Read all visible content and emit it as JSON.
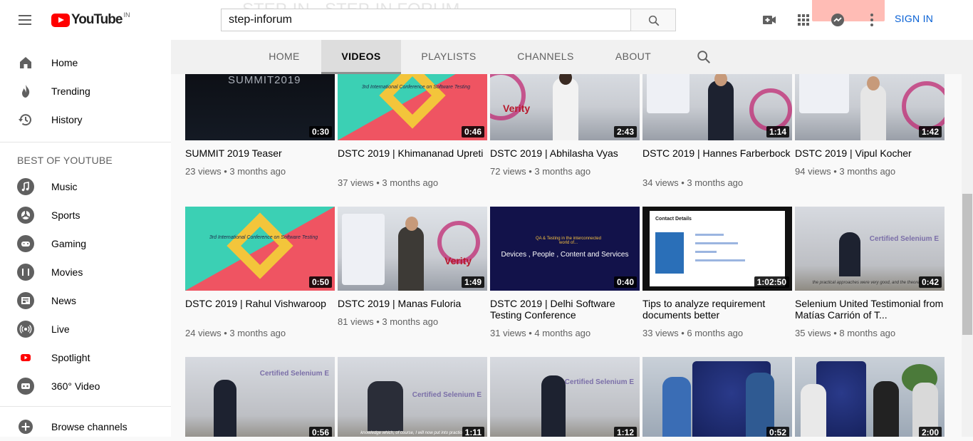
{
  "masthead": {
    "logo_text": "YouTube",
    "country_code": "IN",
    "search_value": "step-inforum",
    "sign_in_label": "SIGN IN",
    "icons": [
      "create-video-icon",
      "apps-grid-icon",
      "messages-icon",
      "more-vert-icon"
    ]
  },
  "sidebar": {
    "primary": [
      {
        "label": "Home",
        "icon": "home-icon"
      },
      {
        "label": "Trending",
        "icon": "trending-flame-icon"
      },
      {
        "label": "History",
        "icon": "history-icon"
      }
    ],
    "section_title": "BEST OF YOUTUBE",
    "best_of": [
      {
        "label": "Music",
        "icon": "music-icon"
      },
      {
        "label": "Sports",
        "icon": "sports-icon"
      },
      {
        "label": "Gaming",
        "icon": "gaming-icon"
      },
      {
        "label": "Movies",
        "icon": "movies-icon"
      },
      {
        "label": "News",
        "icon": "news-icon"
      },
      {
        "label": "Live",
        "icon": "live-icon"
      },
      {
        "label": "Spotlight",
        "icon": "spotlight-icon"
      },
      {
        "label": "360° Video",
        "icon": "vr-360-icon"
      }
    ],
    "browse_channels": "Browse channels"
  },
  "tabs": [
    {
      "label": "HOME"
    },
    {
      "label": "VIDEOS",
      "active": true
    },
    {
      "label": "PLAYLISTS"
    },
    {
      "label": "CHANNELS"
    },
    {
      "label": "ABOUT"
    }
  ],
  "videos": [
    {
      "title": "SUMMIT 2019 Teaser",
      "views": "23 views",
      "age": "3 months ago",
      "duration": "0:30"
    },
    {
      "title": "DSTC 2019 | Khimananad Upreti",
      "views": "37 views",
      "age": "3 months ago",
      "duration": "0:46"
    },
    {
      "title": "DSTC 2019 | Abhilasha Vyas",
      "views": "72 views",
      "age": "3 months ago",
      "duration": "2:43"
    },
    {
      "title": "DSTC 2019 | Hannes Farberbock",
      "views": "34 views",
      "age": "3 months ago",
      "duration": "1:14"
    },
    {
      "title": "DSTC 2019 | Vipul Kocher",
      "views": "94 views",
      "age": "3 months ago",
      "duration": "1:42"
    },
    {
      "title": "DSTC 2019 | Rahul Vishwaroop",
      "views": "24 views",
      "age": "3 months ago",
      "duration": "0:50"
    },
    {
      "title": "DSTC 2019 | Manas Fuloria",
      "views": "81 views",
      "age": "3 months ago",
      "duration": "1:49"
    },
    {
      "title": "DSTC 2019 | Delhi Software Testing Conference",
      "views": "31 views",
      "age": "4 months ago",
      "duration": "0:40"
    },
    {
      "title": "Tips to analyze requirement documents better",
      "views": "33 views",
      "age": "6 months ago",
      "duration": "1:02:50"
    },
    {
      "title": "Selenium United Testimonial from Matías Carrión of T...",
      "views": "35 views",
      "age": "8 months ago",
      "duration": "0:42"
    },
    {
      "title": "",
      "views": "",
      "age": "",
      "duration": "0:56"
    },
    {
      "title": "",
      "views": "",
      "age": "",
      "duration": "1:11"
    },
    {
      "title": "",
      "views": "",
      "age": "",
      "duration": "1:12"
    },
    {
      "title": "",
      "views": "",
      "age": "",
      "duration": "0:52"
    },
    {
      "title": "",
      "views": "",
      "age": "",
      "duration": "2:00"
    }
  ],
  "thumb_text": {
    "summit": "SUMMIT2019",
    "conference": "3rd International Conference on Software Testing",
    "verity": "Verity",
    "navy_small": "QA & Testing in the interconnected world of...",
    "navy_main": "Devices , People , Content and Services",
    "contact_title": "Contact Details",
    "certified": "Certified Selenium E",
    "subtitle_1": "the practical approaches were very good, and the theoretical",
    "subtitle_2": "knowledge which, of course, I will now put into practice"
  }
}
